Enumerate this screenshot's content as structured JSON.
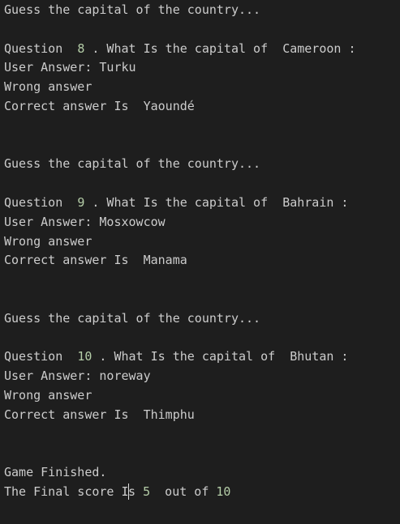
{
  "terminal": {
    "guess_prompt": "Guess the capital of the country...",
    "rounds": [
      {
        "question_prefix": "Question  ",
        "number": "8",
        "question_mid": " . What Is the capital of  ",
        "country": "Cameroon",
        "question_suffix": " :",
        "user_answer_label": "User Answer: ",
        "user_answer": "Turku",
        "result": "Wrong answer",
        "correct_label": "Correct answer Is  ",
        "correct_answer": "Yaoundé"
      },
      {
        "question_prefix": "Question  ",
        "number": "9",
        "question_mid": " . What Is the capital of  ",
        "country": "Bahrain",
        "question_suffix": " :",
        "user_answer_label": "User Answer: ",
        "user_answer": "Mosxowcow",
        "result": "Wrong answer",
        "correct_label": "Correct answer Is  ",
        "correct_answer": "Manama"
      },
      {
        "question_prefix": "Question  ",
        "number": "10",
        "question_mid": " . What Is the capital of  ",
        "country": "Bhutan",
        "question_suffix": " :",
        "user_answer_label": "User Answer: ",
        "user_answer": "noreway",
        "result": "Wrong answer",
        "correct_label": "Correct answer Is  ",
        "correct_answer": "Thimphu"
      }
    ],
    "game_finished": "Game Finished.",
    "final_score_prefix_a": "The Final score I",
    "final_score_prefix_b": "s ",
    "final_score": "5",
    "final_score_mid": "  out of ",
    "final_total": "10"
  },
  "colors": {
    "background": "#1e1e1e",
    "text": "#cccccc",
    "number": "#b5cea8"
  }
}
